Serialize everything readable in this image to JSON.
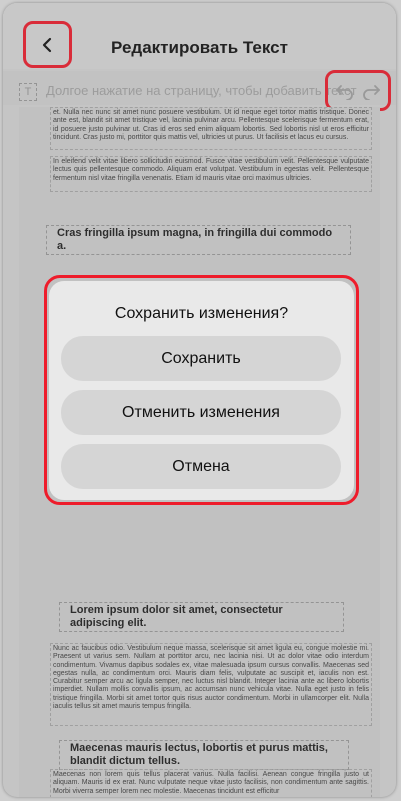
{
  "header": {
    "title": "Редактировать Текст"
  },
  "toolbar": {
    "text_tool_label": "T",
    "hint": "Долгое нажатие на страницу, чтобы добавить текст"
  },
  "document": {
    "para1": "et. Nulla nec nunc sit amet nunc posuere vestibulum. Ut id neque eget tortor mattis tristique. Donec ante est, blandit sit amet tristique vel, lacinia pulvinar arcu. Pellentesque scelerisque fermentum erat, id posuere justo pulvinar ut. Cras id eros sed enim aliquam lobortis. Sed lobortis nisl ut eros efficitur tincidunt. Cras justo mi, porttitor quis mattis vel, ultricies ut purus. Ut facilisis et lacus eu cursus.",
    "para2": "In eleifend velit vitae libero sollicitudin euismod. Fusce vitae vestibulum velit. Pellentesque vulputate lectus quis pellentesque commodo. Aliquam erat volutpat. Vestibulum in egestas velit. Pellentesque fermentum nisl vitae fringilla venenatis. Etiam id mauris vitae orci maximus ultricies.",
    "heading1": "Cras fringilla ipsum magna, in fringilla dui commodo a.",
    "heading2": "Lorem ipsum dolor sit amet, consectetur adipiscing elit.",
    "para3": "Nunc ac faucibus odio. Vestibulum neque massa, scelerisque sit amet ligula eu, congue molestie mi. Praesent ut varius sem. Nullam at porttitor arcu, nec lacinia nisi. Ut ac dolor vitae odio interdum condimentum. Vivamus dapibus sodales ex, vitae malesuada ipsum cursus convallis. Maecenas sed egestas nulla, ac condimentum orci. Mauris diam felis, vulputate ac suscipit et, iaculis non est. Curabitur semper arcu ac ligula semper, nec luctus nisl blandit. Integer lacinia ante ac libero lobortis imperdiet. Nullam mollis convallis ipsum, ac accumsan nunc vehicula vitae. Nulla eget justo in felis tristique fringilla. Morbi sit amet tortor quis risus auctor condimentum. Morbi in ullamcorper elit. Nulla iaculis tellus sit amet mauris tempus fringilla.",
    "heading3": "Maecenas mauris lectus, lobortis et purus mattis, blandit dictum tellus.",
    "para4": "Maecenas non lorem quis tellus placerat varius. Nulla facilisi. Aenean congue fringilla justo ut aliquam. Mauris id ex erat. Nunc vulputate neque vitae justo facilisis, non condimentum ante sagittis. Morbi viverra semper lorem nec molestie. Maecenas tincidunt est efficitur"
  },
  "dialog": {
    "title": "Сохранить изменения?",
    "save_label": "Сохранить",
    "discard_label": "Отменить изменения",
    "cancel_label": "Отмена"
  },
  "colors": {
    "highlight": "#ee1c2b",
    "dialog_bg": "#e9e9e9",
    "button_bg": "#d5d5d5"
  }
}
